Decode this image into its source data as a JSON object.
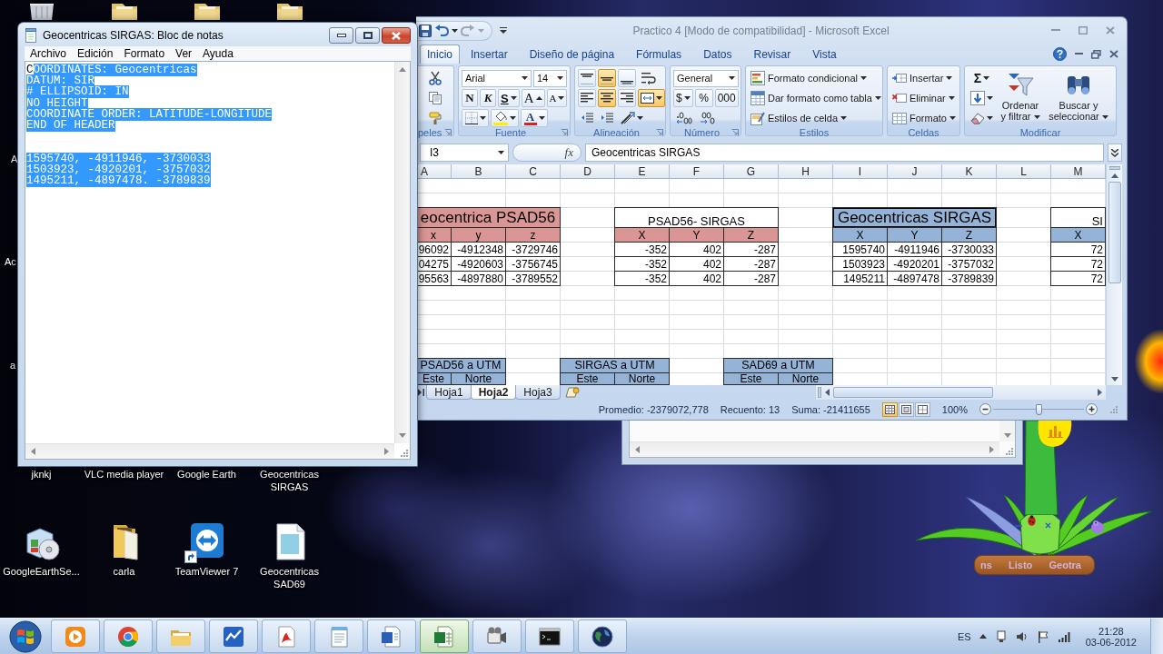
{
  "desktop": {
    "edge_labels": [
      "A",
      "Ac",
      "a"
    ],
    "covered_labels": [
      "jknkj",
      "VLC media player",
      "Google Earth",
      "Geocentricas SIRGAS"
    ],
    "icons": [
      {
        "kind": "installer",
        "label": "GoogleEarthSe...",
        "shortcut": false
      },
      {
        "kind": "folder",
        "label": "carla",
        "shortcut": false
      },
      {
        "kind": "remote",
        "label": "TeamViewer 7",
        "shortcut": true
      },
      {
        "kind": "text_file",
        "label": "Geocentricas SAD69",
        "shortcut": false
      }
    ]
  },
  "notepad": {
    "title": "Geocentricas SIRGAS: Bloc de notas",
    "menu": [
      "Archivo",
      "Edición",
      "Formato",
      "Ver",
      "Ayuda"
    ],
    "lines": [
      {
        "kind": "text",
        "segments": [
          {
            "text": "C",
            "selected": false
          },
          {
            "text": "OORDINATES: Geocentricas",
            "selected": true
          }
        ]
      },
      {
        "kind": "text",
        "segments": [
          {
            "text": "DATUM: SIR",
            "selected": true
          }
        ]
      },
      {
        "kind": "text",
        "segments": [
          {
            "text": "# ELLIPSOID: IN",
            "selected": true
          }
        ]
      },
      {
        "kind": "text",
        "segments": [
          {
            "text": "NO HEIGHT",
            "selected": true
          }
        ]
      },
      {
        "kind": "text",
        "segments": [
          {
            "text": "COORDINATE ORDER: LATITUDE-LONGITUDE",
            "selected": true
          }
        ]
      },
      {
        "kind": "text",
        "segments": [
          {
            "text": "END OF HEADER",
            "selected": true
          }
        ]
      },
      {
        "kind": "blank"
      },
      {
        "kind": "blank"
      },
      {
        "kind": "text",
        "segments": [
          {
            "text": "1595740, -4911946, -3730033",
            "selected": true
          }
        ]
      },
      {
        "kind": "text",
        "segments": [
          {
            "text": "1503923, -4920201, -3757032",
            "selected": true
          }
        ]
      },
      {
        "kind": "text",
        "segments": [
          {
            "text": "1495211, -4897478. -3789839",
            "selected": true
          }
        ]
      }
    ]
  },
  "excel": {
    "title": "Practico 4 [Modo de compatibilidad] - Microsoft Excel",
    "tabs": [
      {
        "label": "Inicio",
        "selected": true
      },
      {
        "label": "Insertar",
        "selected": false
      },
      {
        "label": "Diseño de página",
        "selected": false
      },
      {
        "label": "Fórmulas",
        "selected": false
      },
      {
        "label": "Datos",
        "selected": false
      },
      {
        "label": "Revisar",
        "selected": false
      },
      {
        "label": "Vista",
        "selected": false
      }
    ],
    "ribbon": {
      "clipboard": {
        "label": "peles"
      },
      "font": {
        "label": "Fuente",
        "name": "Arial",
        "size": "14",
        "styles": [
          "N",
          "K",
          "S"
        ],
        "resize": [
          {
            "kind": "grow",
            "label": "A"
          },
          {
            "kind": "shrink",
            "label": "A"
          }
        ],
        "color_label": "A"
      },
      "alignment": {
        "label": "Alineación",
        "vertical": [
          {
            "selected": false
          },
          {
            "selected": true
          },
          {
            "selected": false
          }
        ],
        "horizontal": [
          {
            "selected": false
          },
          {
            "selected": true
          },
          {
            "selected": false
          }
        ],
        "merge": {
          "selected": true
        }
      },
      "number": {
        "label": "Número",
        "format": "General",
        "buttons": [
          "$",
          "%",
          "000"
        ]
      },
      "styles": {
        "label": "Estilos",
        "items": [
          "Formato condicional",
          "Dar formato como tabla",
          "Estilos de celda"
        ]
      },
      "cells": {
        "label": "Celdas",
        "items": [
          "Insertar",
          "Eliminar",
          "Formato"
        ]
      },
      "editing": {
        "label": "Modificar",
        "sum": "Σ",
        "buttons": [
          "Ordenar y filtrar",
          "Buscar y seleccionar"
        ]
      }
    },
    "formula_bar": {
      "cell": "I3",
      "function_label": "fx",
      "content": "Geocentricas SIRGAS"
    },
    "columns": [
      "A",
      "B",
      "C",
      "D",
      "E",
      "F",
      "G",
      "H",
      "I",
      "J",
      "K",
      "L",
      "M"
    ],
    "tables": [
      {
        "kind": "banner",
        "title": {
          "text": "eocentrica PSAD56",
          "color": "#da9694",
          "selected": false
        },
        "header": {
          "color": "#da9694",
          "cells": [
            "x",
            "y",
            "z"
          ]
        },
        "rows": [
          [
            "96092",
            "-4912348",
            "-3729746"
          ],
          [
            "04275",
            "-4920603",
            "-3756745"
          ],
          [
            "95563",
            "-4897880",
            "-3789552"
          ]
        ]
      },
      {
        "kind": "boxed",
        "title": {
          "text": "PSAD56- SIRGAS",
          "color": "#ffffff",
          "selected": false
        },
        "header": {
          "color": "#da9694",
          "cells": [
            "X",
            "Y",
            "Z"
          ]
        },
        "rows": [
          [
            "-352",
            "402",
            "-287"
          ],
          [
            "-352",
            "402",
            "-287"
          ],
          [
            "-352",
            "402",
            "-287"
          ]
        ]
      },
      {
        "kind": "banner",
        "title": {
          "text": "Geocentricas SIRGAS",
          "color": "#95b3d7",
          "selected": true
        },
        "header": {
          "color": "#95b3d7",
          "cells": [
            "X",
            "Y",
            "Z"
          ]
        },
        "rows": [
          [
            "1595740",
            "-4911946",
            "-3730033"
          ],
          [
            "1503923",
            "-4920201",
            "-3757032"
          ],
          [
            "1495211",
            "-4897478",
            "-3789839"
          ]
        ]
      },
      {
        "kind": "boxed",
        "title": {
          "text": "SI",
          "color": "#ffffff",
          "selected": false
        },
        "header": {
          "color": "#95b3d7",
          "cells": [
            "X"
          ]
        },
        "rows": [
          [
            "72"
          ],
          [
            "72"
          ],
          [
            "72"
          ]
        ]
      }
    ],
    "utm_tables": [
      {
        "title": "PSAD56 a UTM",
        "color": "#95b3d7",
        "header": [
          "Este",
          "Norte"
        ]
      },
      {
        "title": "SIRGAS a UTM",
        "color": "#95b3d7",
        "header": [
          "Este",
          "Norte"
        ]
      },
      {
        "title": "SAD69 a UTM",
        "color": "#95b3d7",
        "header": [
          "Este",
          "Norte"
        ]
      }
    ],
    "sheets": [
      {
        "label": "Hoja1",
        "selected": false
      },
      {
        "label": "Hoja2",
        "selected": true
      },
      {
        "label": "Hoja3",
        "selected": false
      }
    ],
    "status": {
      "average": "Promedio: -2379072,778",
      "count": "Recuento: 13",
      "sum": "Suma: -21411655",
      "views": [
        {
          "selected": true
        },
        {
          "selected": false
        },
        {
          "selected": false
        }
      ],
      "zoom": "100%",
      "level": 0.5
    }
  },
  "gadget": {
    "labels": [
      "ns",
      "Listo",
      "Geotra"
    ]
  },
  "taskbar": {
    "apps": [
      {
        "kind": "media",
        "selected": false
      },
      {
        "kind": "browser",
        "selected": false
      },
      {
        "kind": "folder",
        "selected": false
      },
      {
        "kind": "chart",
        "selected": false
      },
      {
        "kind": "pdf",
        "selected": false
      },
      {
        "kind": "notepad",
        "selected": false
      },
      {
        "kind": "word",
        "selected": false
      },
      {
        "kind": "excel",
        "selected": true
      },
      {
        "kind": "film",
        "selected": false
      },
      {
        "kind": "console",
        "selected": false
      },
      {
        "kind": "globe",
        "selected": false
      }
    ],
    "language": "ES",
    "time": "21:28",
    "date": "03-06-2012"
  }
}
